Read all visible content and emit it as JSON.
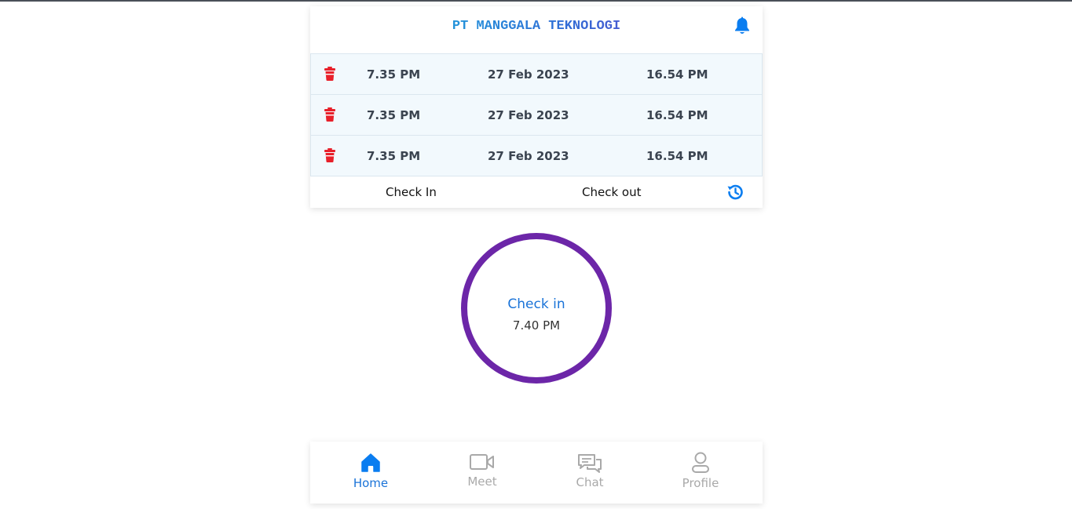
{
  "app": {
    "brand": "PT MANGGALA TEKNOLOGI"
  },
  "colors": {
    "accent": "#1a73d8",
    "ring": "#6c26a8",
    "danger": "#e8202a",
    "inactive": "#a9a9a9"
  },
  "icons": {
    "bell": "bell-icon",
    "trash": "trash-icon",
    "history": "history-icon",
    "home": "home-icon",
    "meet": "video-camera-icon",
    "chat": "chat-icon",
    "profile": "user-icon"
  },
  "attendance": {
    "rows": [
      {
        "check_in": "7.35 PM",
        "date": "27 Feb 2023",
        "check_out": "16.54 PM"
      },
      {
        "check_in": "7.35 PM",
        "date": "27 Feb 2023",
        "check_out": "16.54 PM"
      },
      {
        "check_in": "7.35 PM",
        "date": "27 Feb 2023",
        "check_out": "16.54 PM"
      }
    ],
    "labels": {
      "check_in": "Check In",
      "check_out": "Check out"
    }
  },
  "checkin_button": {
    "title": "Check in",
    "time": "7.40 PM"
  },
  "nav": {
    "items": [
      {
        "label": "Home",
        "active": true
      },
      {
        "label": "Meet",
        "active": false
      },
      {
        "label": "Chat",
        "active": false
      },
      {
        "label": "Profile",
        "active": false
      }
    ]
  }
}
